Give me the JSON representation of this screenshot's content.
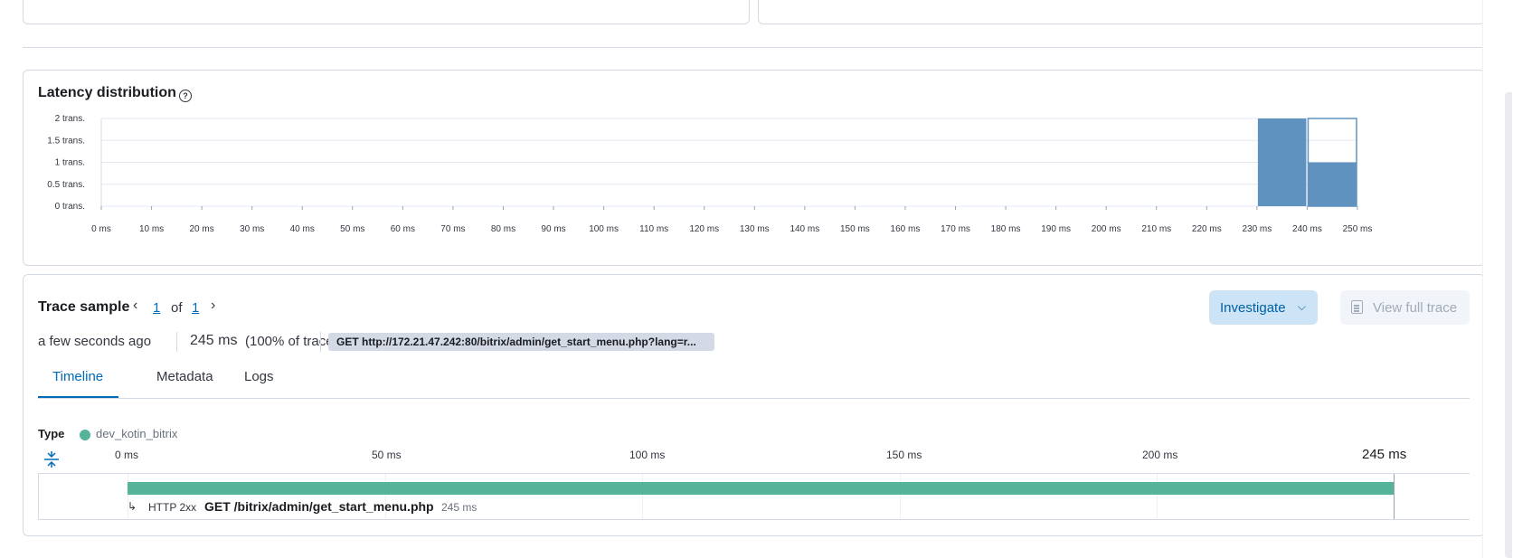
{
  "latency": {
    "title": "Latency distribution",
    "help_icon": "question-circle-icon"
  },
  "chart_data": {
    "type": "bar",
    "title": "Latency distribution",
    "x_ticks": [
      "0 ms",
      "10 ms",
      "20 ms",
      "30 ms",
      "40 ms",
      "50 ms",
      "60 ms",
      "70 ms",
      "80 ms",
      "90 ms",
      "100 ms",
      "110 ms",
      "120 ms",
      "130 ms",
      "140 ms",
      "150 ms",
      "160 ms",
      "170 ms",
      "180 ms",
      "190 ms",
      "200 ms",
      "210 ms",
      "220 ms",
      "230 ms",
      "240 ms",
      "250 ms"
    ],
    "y_ticks": [
      "0 trans.",
      "0.5 trans.",
      "1 trans.",
      "1.5 trans.",
      "2 trans."
    ],
    "xlim": [
      0,
      250
    ],
    "ylim": [
      0,
      2
    ],
    "grid": true,
    "bars": [
      {
        "x0": 230,
        "x1": 240,
        "value": 2
      },
      {
        "x0": 240,
        "x1": 250,
        "value": 1
      }
    ],
    "selection": {
      "x0": 240,
      "x1": 250
    },
    "bar_color": "#6092c0"
  },
  "trace": {
    "title": "Trace sample",
    "current": "1",
    "of_label": "of",
    "total": "1",
    "investigate_label": "Investigate",
    "view_full_trace_label": "View full trace",
    "timestamp": "a few seconds ago",
    "duration": "245 ms",
    "duration_pct": "(100% of trace)",
    "url": "GET http://172.21.47.242:80/bitrix/admin/get_start_menu.php?lang=r...",
    "tabs": [
      {
        "label": "Timeline"
      },
      {
        "label": "Metadata"
      },
      {
        "label": "Logs"
      }
    ],
    "active_tab": "Timeline"
  },
  "timeline": {
    "type_label": "Type",
    "service_name": "dev_kotin_bitrix",
    "service_color": "#54b399",
    "ticks": [
      "0 ms",
      "50 ms",
      "100 ms",
      "150 ms",
      "200 ms"
    ],
    "end_label": "245 ms",
    "span": {
      "status": "HTTP 2xx",
      "name": "GET /bitrix/admin/get_start_menu.php",
      "duration": "245 ms"
    }
  }
}
